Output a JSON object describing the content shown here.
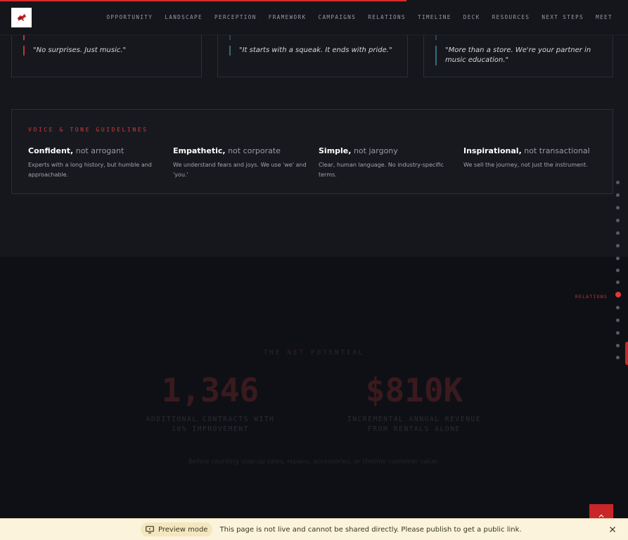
{
  "progress": 0.647,
  "nav": {
    "items": [
      "OPPORTUNITY",
      "LANDSCAPE",
      "PERCEPTION",
      "FRAMEWORK",
      "CAMPAIGNS",
      "RELATIONS",
      "TIMELINE",
      "DECK",
      "RESOURCES",
      "NEXT STEPS",
      "MEET"
    ]
  },
  "quotes": [
    "\"No surprises. Just music.\"",
    "\"It starts with a squeak. It ends with pride.\"",
    "\"More than a store. We're your partner in music education.\""
  ],
  "voice": {
    "heading": "VOICE & TONE GUIDELINES",
    "items": [
      {
        "strong": "Confident,",
        "not": "not arrogant",
        "desc": "Experts with a long history, but humble and approachable."
      },
      {
        "strong": "Empathetic,",
        "not": "not corporate",
        "desc": "We understand fears and joys. We use 'we' and 'you.'"
      },
      {
        "strong": "Simple,",
        "not": "not jargony",
        "desc": "Clear, human language. No industry-specific terms."
      },
      {
        "strong": "Inspirational,",
        "not": "not transactional",
        "desc": "We sell the journey, not just the instrument."
      }
    ]
  },
  "impact": {
    "label": "THE NET POTENTIAL",
    "stats": [
      {
        "value": "1,346",
        "caption_line1": "ADDITIONAL CONTRACTS WITH",
        "caption_line2": "10% IMPROVEMENT"
      },
      {
        "value": "$810K",
        "caption_line1": "INCREMENTAL ANNUAL REVENUE",
        "caption_line2": "FROM RENTALS ALONE"
      }
    ],
    "footnote": "Before counting step-up sales, repairs, accessories, or lifetime customer value."
  },
  "side_nav": {
    "active_label": "RELATIONS"
  },
  "banner": {
    "pill_label": "Preview mode",
    "message": "This page is not live and cannot be shared directly. Please publish to get a public link."
  },
  "colors": {
    "accent": "#d92c2c",
    "background": "#16171d",
    "banner": "#fbf3dc"
  }
}
